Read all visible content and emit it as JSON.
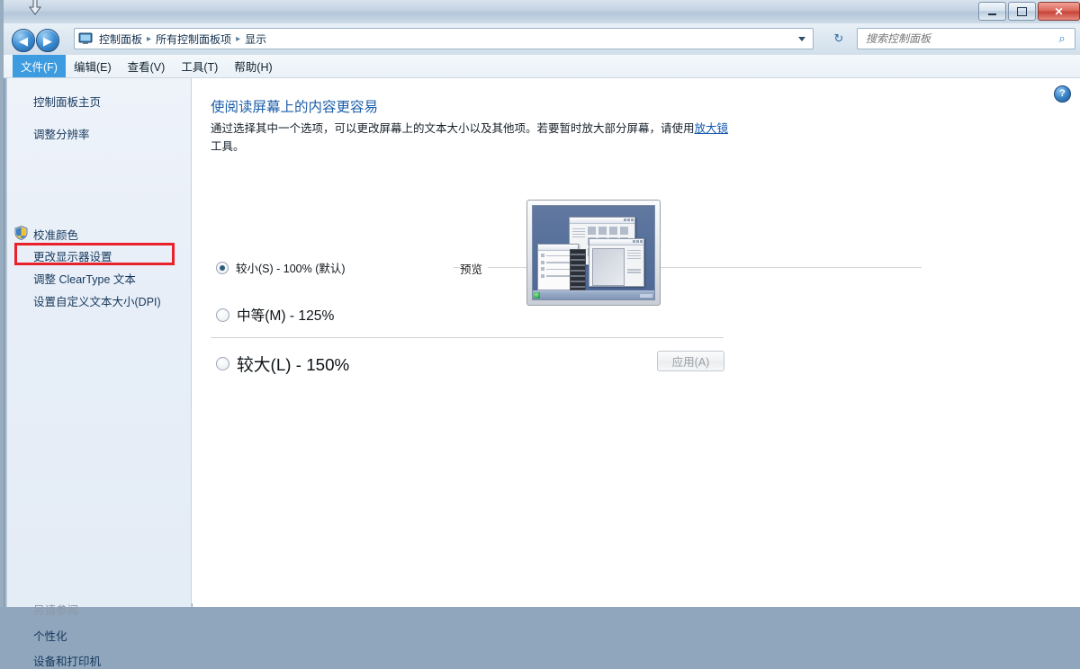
{
  "window": {
    "minimize_label": "最小化",
    "maximize_label": "最大化",
    "close_label": "关闭"
  },
  "nav": {
    "back_label": "后退",
    "forward_label": "前进",
    "history_label": "最近浏览的位置",
    "refresh_label": "刷新",
    "breadcrumb": [
      "控制面板",
      "所有控制面板项",
      "显示"
    ],
    "separator": "▸"
  },
  "search": {
    "placeholder": "搜索控制面板",
    "value": "",
    "icon": "search-icon"
  },
  "menubar": {
    "items": [
      {
        "label": "文件(F)",
        "active": true
      },
      {
        "label": "编辑(E)",
        "active": false
      },
      {
        "label": "查看(V)",
        "active": false
      },
      {
        "label": "工具(T)",
        "active": false
      },
      {
        "label": "帮助(H)",
        "active": false
      }
    ]
  },
  "sidebar": {
    "home_label": "控制面板主页",
    "items": [
      {
        "label": "调整分辨率",
        "shield": false,
        "highlighted": false
      },
      {
        "label": "校准颜色",
        "shield": true,
        "highlighted": false
      },
      {
        "label": "更改显示器设置",
        "shield": false,
        "highlighted": true
      },
      {
        "label": "调整 ClearType 文本",
        "shield": false,
        "highlighted": false
      },
      {
        "label": "设置自定义文本大小(DPI)",
        "shield": false,
        "highlighted": false
      }
    ],
    "see_also_title": "另请参阅",
    "see_also_items": [
      "个性化",
      "设备和打印机"
    ]
  },
  "main": {
    "help_icon_label": "?",
    "title": "使阅读屏幕上的内容更容易",
    "description_before": "通过选择其中一个选项，可以更改屏幕上的文本大小以及其他项。若要暂时放大部分屏幕，请使用",
    "description_link": "放大镜",
    "description_after": "工具。",
    "options": [
      {
        "label": "较小(S) - 100% (默认)",
        "selected": true,
        "scale": "100%"
      },
      {
        "label": "中等(M) - 125%",
        "selected": false,
        "scale": "125%"
      },
      {
        "label": "较大(L) - 150%",
        "selected": false,
        "scale": "150%"
      }
    ],
    "preview_label": "预览",
    "apply_label": "应用(A)",
    "apply_enabled": false
  },
  "colors": {
    "accent_blue": "#1b5ea8",
    "link_blue": "#1559b0",
    "highlight_red": "#e8212b",
    "menu_active": "#3d9bdf",
    "sidebar_bg": "#eef3fa",
    "preview_desktop": "#56709b"
  }
}
